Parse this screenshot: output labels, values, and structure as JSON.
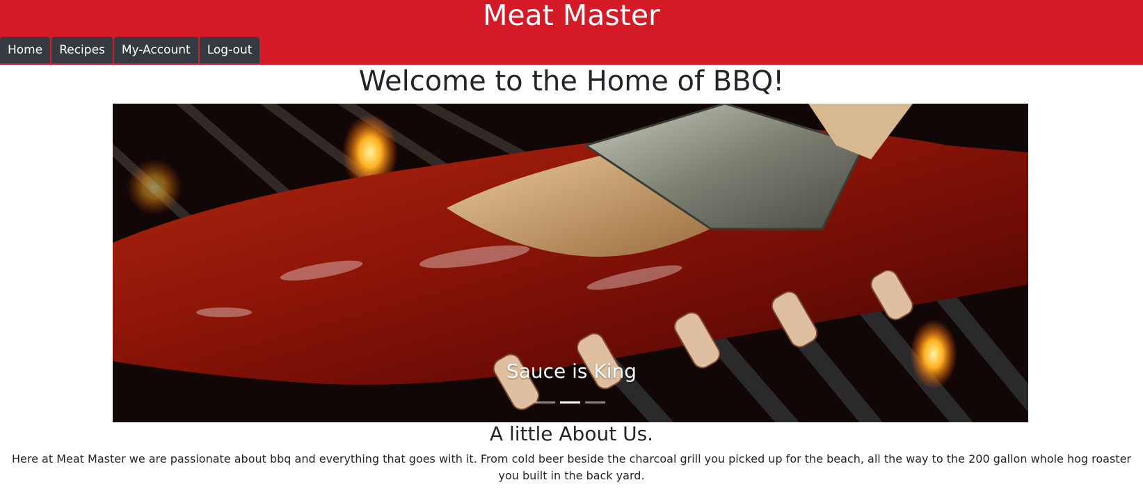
{
  "header": {
    "site_title": "Meat Master",
    "brand_color": "#d41a26",
    "nav": [
      {
        "label": "Home"
      },
      {
        "label": "Recipes"
      },
      {
        "label": "My-Account"
      },
      {
        "label": "Log-out"
      }
    ]
  },
  "main": {
    "welcome_heading": "Welcome to the Home of BBQ!",
    "carousel": {
      "active_slide_caption": "Sauce is King",
      "slide_count": 3,
      "active_index": 1,
      "image_subject": "ribs-with-sauce-brush-on-grill"
    },
    "about": {
      "title": "A little About Us.",
      "text": "Here at Meat Master we are passionate about bbq and everything that goes with it. From cold beer beside the charcoal grill you picked up for the beach, all the way to the 200 gallon whole hog roaster you built in the back yard."
    }
  }
}
